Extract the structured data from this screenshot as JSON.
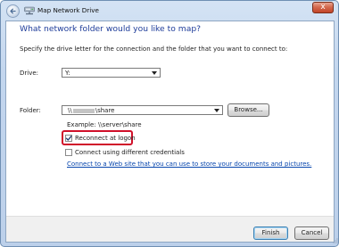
{
  "window": {
    "title": "Map Network Drive",
    "close_glyph": "x",
    "icons": {
      "back": "back-arrow-icon",
      "app": "network-drive-icon",
      "close": "close-icon"
    }
  },
  "main": {
    "heading": "What network folder would you like to map?",
    "intro": "Specify the drive letter for the connection and the folder that you want to connect to:",
    "drive": {
      "label": "Drive:",
      "value": "Y:"
    },
    "folder": {
      "label": "Folder:",
      "value_prefix": "\\\\",
      "value_suffix": "\\share",
      "browse_label": "Browse..."
    },
    "example": "Example: \\\\server\\share",
    "reconnect": {
      "label": "Reconnect at logon",
      "checked": true
    },
    "different_credentials": {
      "label": "Connect using different credentials",
      "checked": false
    },
    "link": "Connect to a Web site that you can use to store your documents and pictures."
  },
  "footer": {
    "finish_label": "Finish",
    "cancel_label": "Cancel"
  },
  "colors": {
    "heading": "#1f3d9a",
    "link": "#0645ad",
    "highlight": "#d0102a",
    "frame": "#c3d6ee"
  }
}
